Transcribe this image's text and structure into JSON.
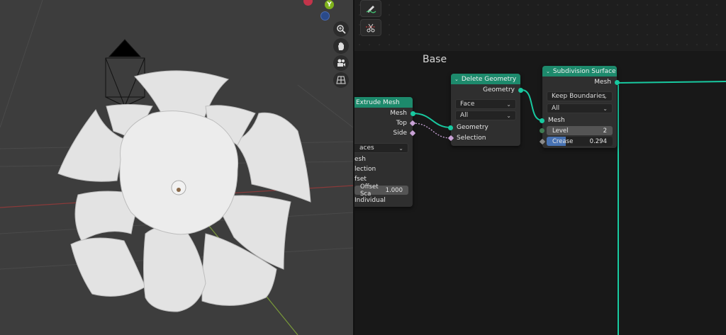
{
  "viewport": {
    "gizmo": {
      "y_label": "Y"
    }
  },
  "node_editor": {
    "frame_label": "Base",
    "nodes": {
      "extrude_mesh": {
        "title": "Extrude Mesh",
        "outputs": [
          "Mesh",
          "Top",
          "Side"
        ],
        "mode_dropdown": "aces",
        "inputs": [
          "esh",
          "lection",
          "fset"
        ],
        "offset_scale_label": "Offset Sca",
        "offset_scale_value": "1.000",
        "individual_label": "Individual"
      },
      "delete_geometry": {
        "title": "Delete Geometry",
        "output": "Geometry",
        "domain_dropdown": "Face",
        "mode_dropdown": "All",
        "inputs": [
          "Geometry",
          "Selection"
        ]
      },
      "subdivision_surface": {
        "title": "Subdivision Surface",
        "output": "Mesh",
        "boundary_dropdown": "Keep Boundaries",
        "uv_dropdown": "All",
        "input_mesh": "Mesh",
        "level_label": "Level",
        "level_value": "2",
        "crease_label": "Crease",
        "crease_value": "0.294",
        "crease_fraction": 0.294
      }
    }
  },
  "colors": {
    "node_header": "#1d8a6c",
    "geometry_socket": "#18c9a0",
    "selection_socket": "#c9a2d6",
    "crease_fill": "#4772b3"
  }
}
